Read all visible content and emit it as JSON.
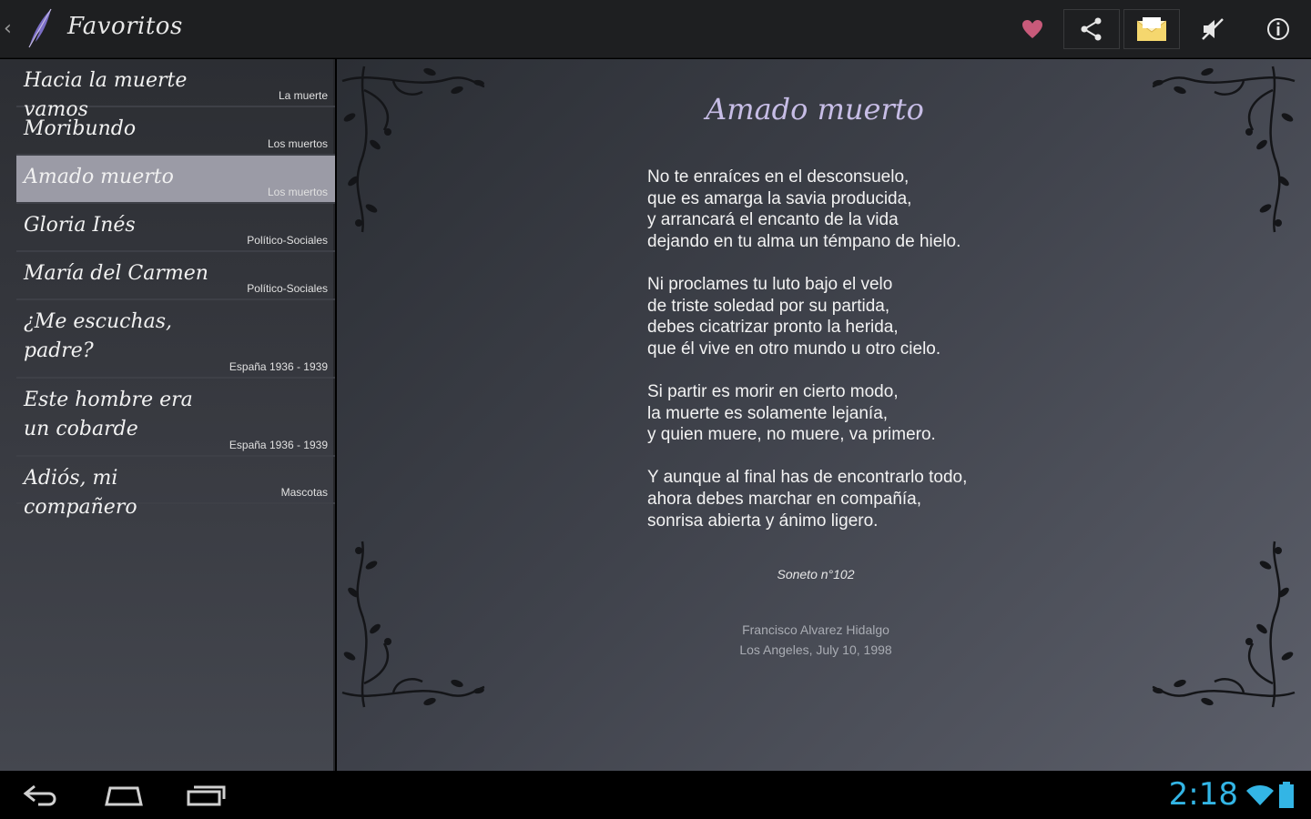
{
  "actionbar": {
    "title": "Favoritos",
    "accent": "#c85a7a"
  },
  "list": {
    "items": [
      {
        "title": "Hacia la muerte vamos",
        "category": "La muerte",
        "selected": false
      },
      {
        "title": "Moribundo",
        "category": "Los muertos",
        "selected": false
      },
      {
        "title": "Amado muerto",
        "category": "Los muertos",
        "selected": true
      },
      {
        "title": "Gloria Inés",
        "category": "Político-Sociales",
        "selected": false
      },
      {
        "title": "María del Carmen",
        "category": "Político-Sociales",
        "selected": false
      },
      {
        "title": "¿Me escuchas, padre?",
        "category": "España 1936 - 1939",
        "selected": false
      },
      {
        "title": "Este hombre era un cobarde",
        "category": "España 1936 - 1939",
        "selected": false
      },
      {
        "title": "Adiós, mi compañero",
        "category": "Mascotas",
        "selected": false
      }
    ]
  },
  "poem": {
    "title": "Amado muerto",
    "stanzas": [
      [
        "No te enraíces en el desconsuelo,",
        "que es amarga la savia producida,",
        "y arrancará el encanto de la vida",
        "dejando en tu alma un témpano de hielo."
      ],
      [
        "Ni proclames tu luto bajo el velo",
        "de triste soledad por su partida,",
        "debes cicatrizar pronto la herida,",
        "que él vive en otro mundo u otro cielo."
      ],
      [
        "Si partir es morir en cierto modo,",
        "la muerte es solamente lejanía,",
        "y quien muere, no muere, va primero."
      ],
      [
        "Y aunque al final has de encontrarlo todo,",
        "ahora debes marchar en compañía,",
        "sonrisa abierta y ánimo ligero."
      ]
    ],
    "subtitle": "Soneto n°102",
    "author": "Francisco Alvarez Hidalgo",
    "place_date": "Los Angeles, July 10, 1998"
  },
  "statusbar": {
    "time": "2:18",
    "accent": "#33b5e5"
  }
}
